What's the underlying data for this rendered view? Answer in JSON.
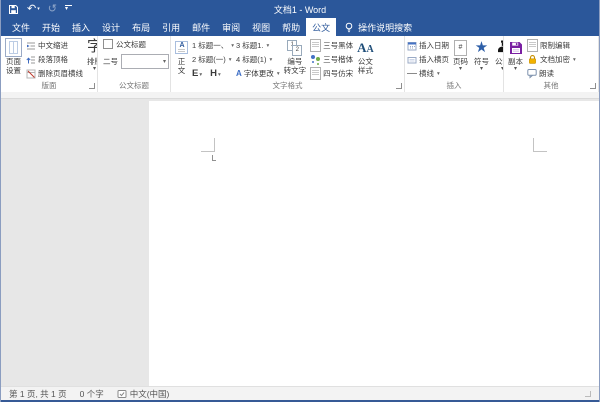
{
  "titlebar": {
    "title": "文档1 - Word"
  },
  "tabs": {
    "items": [
      "文件",
      "开始",
      "插入",
      "设计",
      "布局",
      "引用",
      "邮件",
      "审阅",
      "视图",
      "帮助",
      "公文"
    ],
    "search_label": "操作说明搜索"
  },
  "ribbon": {
    "layout": {
      "label": "版面",
      "page_setup_1": "页面",
      "page_setup_2": "设置",
      "chinese_indent": "中文缩进",
      "paragraph_top": "段落顶格",
      "remove_header_line": "删除页眉横线",
      "typeset": "排版"
    },
    "doc_title": {
      "label": "公文标题",
      "checkbox": "公文标题",
      "size": "二号",
      "combo_value": ""
    },
    "text_format": {
      "label": "文字格式",
      "body_1": "正",
      "body_2": "文",
      "h1": "1 标题一、",
      "h2": "2 标题(一)",
      "btn_e": "E",
      "btn_h": "H",
      "h3": "3 标题1.",
      "h4": "4 标题(1)",
      "font_change": "字体更改",
      "num2text_1": "编号",
      "num2text_2": "转文字",
      "hei": "三号黑体",
      "kai": "三号楷体",
      "fang": "四号仿宋",
      "style_1": "公文",
      "style_2": "样式"
    },
    "insert": {
      "label": "插入",
      "date": "插入日期",
      "landscape": "插入横页",
      "hline": "横线",
      "page_number": "页码",
      "symbol": "符号",
      "seal": "公章"
    },
    "other": {
      "label": "其他",
      "copy": "副本",
      "restrict": "限制编辑",
      "encrypt": "文档加密",
      "read_aloud": "朗读"
    }
  },
  "statusbar": {
    "page_info": "第 1 页, 共 1 页",
    "word_count": "0 个字",
    "language": "中文(中国)"
  },
  "icons": {
    "undo": "↶",
    "redo": "↺",
    "typeset_glyph": "字",
    "body_a": "A",
    "num1": "1",
    "num2": "2",
    "hash": "#",
    "star": "★",
    "style_a1": "A",
    "style_a2": "A",
    "font_change_a": "A"
  },
  "colors": {
    "titlebar": "#2b579a",
    "accent": "#2b579a",
    "star_blue": "#2e5fa8",
    "seal_black": "#151515",
    "copy_purple": "#7a1fa2",
    "lock_gold": "#f2b200",
    "doc_bg": "#e7e7e7",
    "status_bg": "#f3f3f3"
  }
}
